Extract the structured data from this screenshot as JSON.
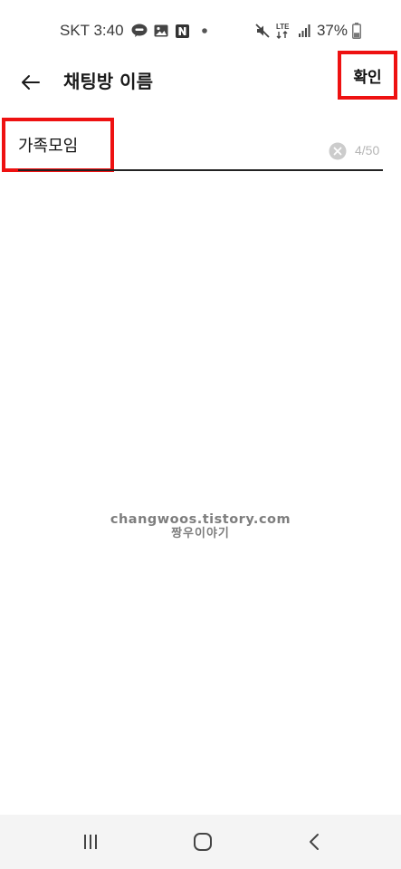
{
  "status_bar": {
    "carrier_time": "SKT 3:40",
    "notification_icons": [
      "talk-chat-icon",
      "gallery-icon",
      "naver-icon",
      "more-dot-icon"
    ],
    "system_icons": [
      "mute-icon",
      "lte-icon",
      "signal-icon"
    ],
    "network_label": "LTE",
    "battery_percent": "37%",
    "battery_level": 0.37
  },
  "app_bar": {
    "title": "채팅방 이름",
    "confirm_label": "확인"
  },
  "name_field": {
    "value": "가족모임",
    "char_count": "4/50"
  },
  "watermark": {
    "line1": "changwoos.tistory.com",
    "line2": "짱우이야기"
  },
  "nav_bar": {
    "buttons": [
      "recent-apps-icon",
      "home-icon",
      "back-icon"
    ]
  },
  "colors": {
    "highlight": "#ee1111",
    "background": "#ffffff",
    "nav_background": "#f4f4f4",
    "counter": "#b5b5b5"
  }
}
